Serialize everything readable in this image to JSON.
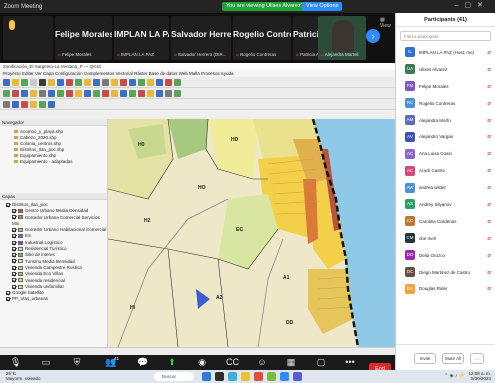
{
  "window": {
    "title": "Zoom Meeting",
    "share_banner": "You are viewing Ulises Alvarez's screen",
    "view_options": "View Options"
  },
  "strip": {
    "tiles": [
      {
        "name": "",
        "sub": ""
      },
      {
        "name": "Felipe Morales",
        "sub": "Felipe Morales"
      },
      {
        "name": "IMPLAN LA PAZ",
        "sub": "IMPLAN LA PAZ"
      },
      {
        "name": "Salvador Herrer...",
        "sub": "Salvador Herrera (DIR..."
      },
      {
        "name": "Rogelio Contreras",
        "sub": "Rogelio Contreras"
      },
      {
        "name": "Patricia Ayala",
        "sub": "Patricia Ayala"
      },
      {
        "name": "",
        "sub": "Alejandra Martell"
      }
    ],
    "view_label": "View"
  },
  "qgis": {
    "title": "Zonificación_El Sargento-La Ventana_P — QGIS",
    "menu": "Proyecto  Editar  Ver  Capa  Configuración  Complementos  Vectorial  Ráster  Base de datos  Web  Malla  Procesos  Ayuda",
    "browser_header": "Navegador",
    "browser_items": [
      "Acomoo_y_playa.shp",
      "Cabezo_2020.shp",
      "Colonia_centros.shp",
      "Distritos_Ilan_poc.shp",
      "Equipamiento.shp",
      "Equipamiento - adaptadas"
    ],
    "layers_header": "Capas",
    "layers": [
      {
        "label": "Distritos_Ilan_poc",
        "color": ""
      },
      {
        "label": "Centro Urbano Media Densidad",
        "color": "#b9553f"
      },
      {
        "label": "Corredor Urbano Comercial Servicios Mix",
        "color": "#d97a3a"
      },
      {
        "label": "Corredor Urbano Habitacional Comercial",
        "color": "#e0b04e"
      },
      {
        "label": "ES",
        "color": "#5a79c8"
      },
      {
        "label": "Industrial Logístico",
        "color": "#8e44ad"
      },
      {
        "label": "Residencial Turístico",
        "color": "#eadf8a"
      },
      {
        "label": "Sitio de interes",
        "color": "#7fb36a"
      },
      {
        "label": "Turismo Media Densidad",
        "color": "#f1ec9a"
      },
      {
        "label": "Vivienda Campestre Rustica",
        "color": "#c8d98f"
      },
      {
        "label": "Vivienda Eco Villas",
        "color": "#a7c97d"
      },
      {
        "label": "Vivienda residencial",
        "color": "#e9e18d"
      },
      {
        "label": "Vivienda unifamiliar",
        "color": "#f4d775"
      },
      {
        "label": "Google Satellite",
        "color": ""
      },
      {
        "label": "PP_Vias_urbanas",
        "color": ""
      }
    ],
    "map_labels": [
      "H0",
      "HD",
      "EC",
      "H2",
      "A2",
      "A1",
      "HI",
      "DD",
      "HO"
    ]
  },
  "controls": {
    "buttons": [
      {
        "label": "Unmute",
        "icon": "microphone-off-icon"
      },
      {
        "label": "Start Video",
        "icon": "video-off-icon"
      },
      {
        "label": "Security",
        "icon": "shield-icon"
      },
      {
        "label": "Participants",
        "icon": "participants-icon",
        "count": "41"
      },
      {
        "label": "Chat",
        "icon": "chat-icon"
      },
      {
        "label": "Share Screen",
        "icon": "share-screen-icon"
      },
      {
        "label": "Record",
        "icon": "record-icon"
      },
      {
        "label": "Captions",
        "icon": "captions-icon"
      },
      {
        "label": "Reactions",
        "icon": "reactions-icon"
      },
      {
        "label": "Apps",
        "icon": "apps-icon"
      },
      {
        "label": "Whiteboards",
        "icon": "whiteboard-icon"
      },
      {
        "label": "More",
        "icon": "more-icon"
      }
    ],
    "end_label": "End"
  },
  "panel": {
    "title": "Participants (41)",
    "search_placeholder": "Find a participant",
    "participants": [
      {
        "initials": "IL",
        "name": "IMPLAN LA PAZ (Host, me)",
        "color": "#2e6fd8"
      },
      {
        "initials": "UA",
        "name": "Ulises Alvarez",
        "color": "#3b7a57"
      },
      {
        "initials": "FM",
        "name": "Felipe Morales",
        "color": "#7e57c2"
      },
      {
        "initials": "RC",
        "name": "Rogelio Contreras",
        "color": "#4a90d9"
      },
      {
        "initials": "AM",
        "name": "Alejandra Morfo",
        "color": "#5c6bc0"
      },
      {
        "initials": "AV",
        "name": "Alejandro Vargas",
        "color": "#3f51b5"
      },
      {
        "initials": "AC",
        "name": "Ana Luisa Coasi",
        "color": "#8e63ce"
      },
      {
        "initials": "AC",
        "name": "Aracli Castro",
        "color": "#d4477a"
      },
      {
        "initials": "AW",
        "name": "andrea wilder",
        "color": "#4a90d9"
      },
      {
        "initials": "AS",
        "name": "Andrey Silyanov",
        "color": "#2e9d6a"
      },
      {
        "initials": "CC",
        "name": "Carolina Cardenas",
        "color": "#c0762c"
      },
      {
        "initials": "CM",
        "name": "cbe mell",
        "color": "#263238"
      },
      {
        "initials": "DO",
        "name": "Delia Orozco",
        "color": "#9c27b0"
      },
      {
        "initials": "DC",
        "name": "Diego Martinez de Castro",
        "color": "#6d4c41"
      },
      {
        "initials": "DA",
        "name": "Douglas Rider",
        "color": "#f2a23a"
      }
    ],
    "invite_label": "Invite",
    "mute_all_label": "Mute All",
    "more_label": "..."
  },
  "taskbar": {
    "weather_temp": "25°C",
    "weather_desc": "Mayorm. soleado",
    "search_label": "Buscar",
    "time": "12:08 a. m.",
    "date": "5/30/2023"
  }
}
